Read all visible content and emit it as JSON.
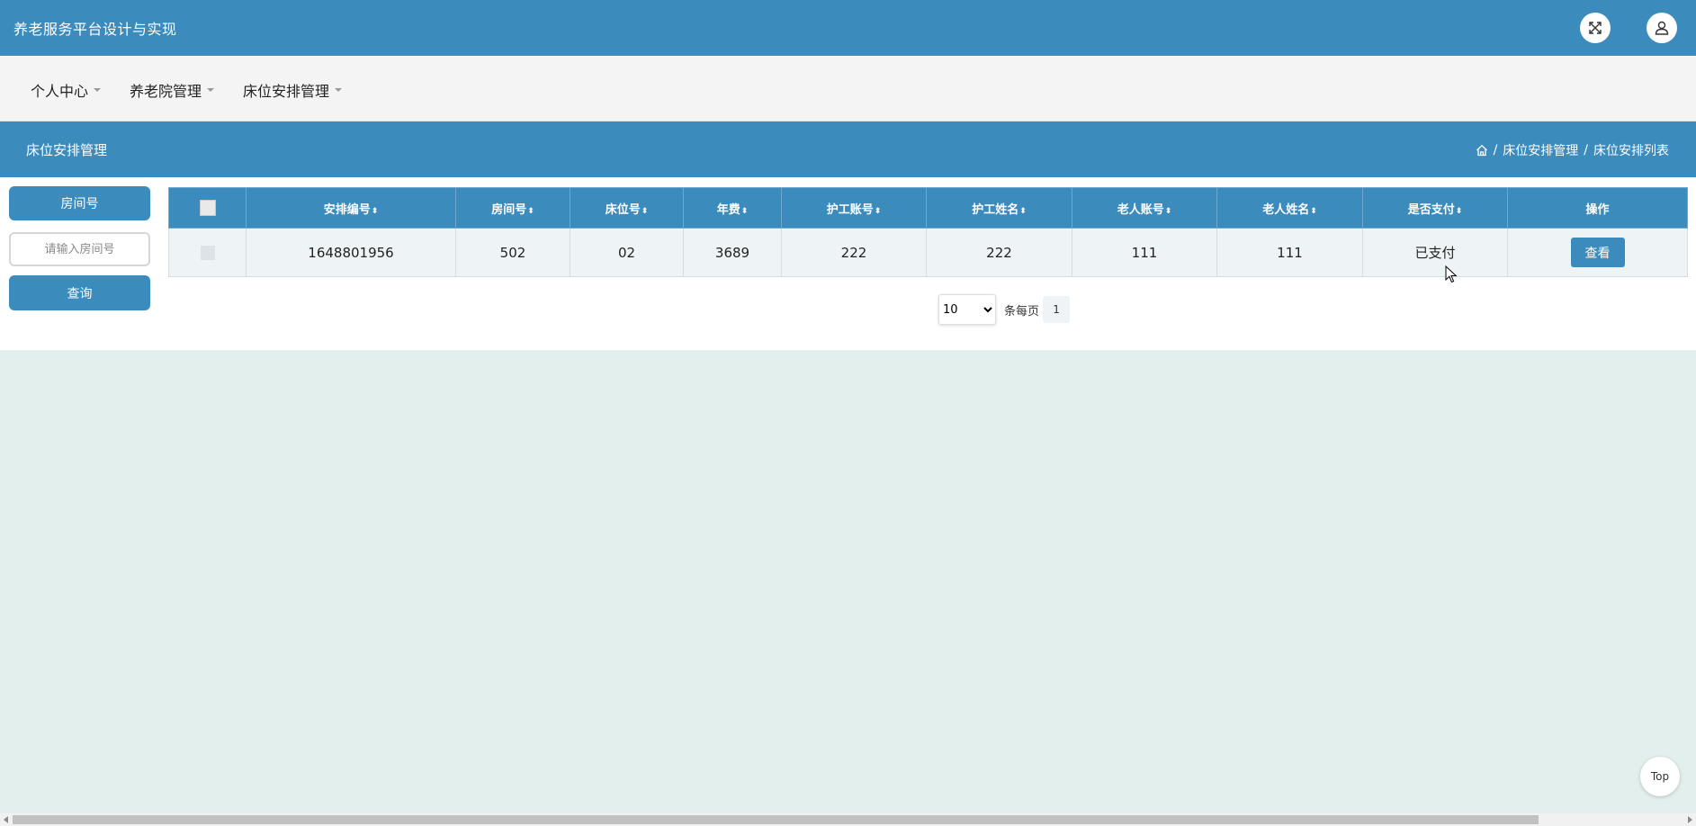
{
  "header": {
    "app_title": "养老服务平台设计与实现",
    "icons": [
      "fullscreen-icon",
      "user-icon"
    ]
  },
  "nav": {
    "items": [
      {
        "label": "个人中心"
      },
      {
        "label": "养老院管理"
      },
      {
        "label": "床位安排管理"
      }
    ]
  },
  "page": {
    "title": "床位安排管理",
    "breadcrumb": [
      "床位安排管理",
      "床位安排列表"
    ],
    "separator": "/"
  },
  "search": {
    "field_label": "房间号",
    "placeholder": "请输入房间号",
    "value": "",
    "button": "查询"
  },
  "table": {
    "columns": [
      {
        "label": "安排编号",
        "sortable": true
      },
      {
        "label": "房间号",
        "sortable": true
      },
      {
        "label": "床位号",
        "sortable": true
      },
      {
        "label": "年费",
        "sortable": true
      },
      {
        "label": "护工账号",
        "sortable": true
      },
      {
        "label": "护工姓名",
        "sortable": true
      },
      {
        "label": "老人账号",
        "sortable": true
      },
      {
        "label": "老人姓名",
        "sortable": true
      },
      {
        "label": "是否支付",
        "sortable": true
      },
      {
        "label": "操作",
        "sortable": false
      }
    ],
    "sort_glyph": "⬍",
    "rows": [
      {
        "cells": [
          "1648801956",
          "502",
          "02",
          "3689",
          "222",
          "222",
          "111",
          "111",
          "已支付"
        ],
        "action": "查看"
      }
    ]
  },
  "pagination": {
    "page_size": "10",
    "page_size_options": [
      "10"
    ],
    "per_page_label": "条每页",
    "current_page": "1"
  },
  "back_to_top": "Top",
  "colors": {
    "primary": "#3c8bbd",
    "page_background": "#e3efec",
    "nav_background": "#f4f4f4"
  }
}
